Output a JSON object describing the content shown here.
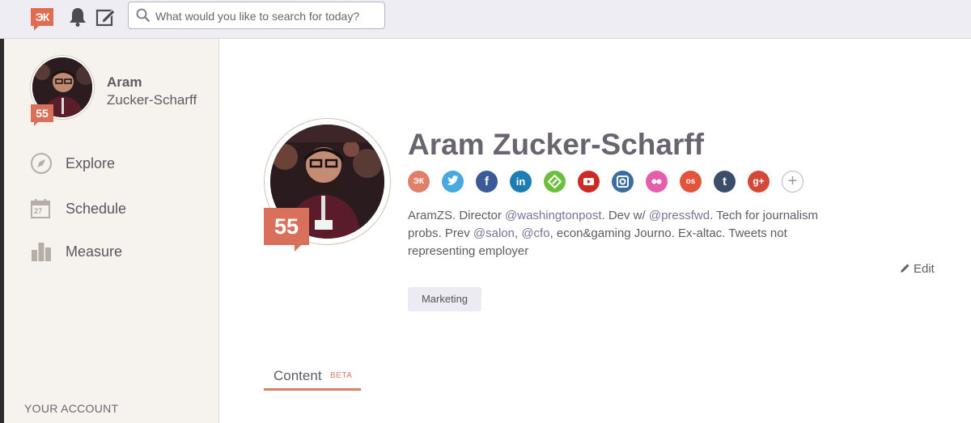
{
  "topbar": {
    "logo_text": "ЭК",
    "search_placeholder": "What would you like to search for today?",
    "icons": [
      "klout-logo-icon",
      "bell-icon",
      "compose-icon",
      "search-icon"
    ]
  },
  "sidebar": {
    "first_name": "Aram",
    "last_name": "Zucker-Scharff",
    "score": "55",
    "nav": [
      {
        "label": "Explore",
        "icon": "compass-icon"
      },
      {
        "label": "Schedule",
        "icon": "calendar-icon"
      },
      {
        "label": "Measure",
        "icon": "bar-chart-icon"
      }
    ],
    "calendar_day": "27",
    "account_label": "YOUR ACCOUNT"
  },
  "profile": {
    "name": "Aram Zucker-Scharff",
    "score": "55",
    "socials": [
      {
        "name": "klout",
        "glyph": "ЭК",
        "color": "#e0806a"
      },
      {
        "name": "twitter",
        "glyph": "t",
        "color": "#4aa8e0"
      },
      {
        "name": "facebook",
        "glyph": "f",
        "color": "#3b5b98"
      },
      {
        "name": "linkedin",
        "glyph": "in",
        "color": "#1f7cb4"
      },
      {
        "name": "feedly",
        "glyph": "f",
        "color": "#6cbf3c"
      },
      {
        "name": "youtube",
        "glyph": "▶",
        "color": "#cc2a24"
      },
      {
        "name": "instagram",
        "glyph": "◎",
        "color": "#3b6da0"
      },
      {
        "name": "flickr",
        "glyph": "••",
        "color": "#e35fae"
      },
      {
        "name": "lastfm",
        "glyph": "os",
        "color": "#e2543c"
      },
      {
        "name": "tumblr",
        "glyph": "t",
        "color": "#3a4e6a"
      },
      {
        "name": "googleplus",
        "glyph": "g+",
        "color": "#d34836"
      },
      {
        "name": "add",
        "glyph": "+",
        "color": "#ffffff"
      }
    ],
    "bio": {
      "p1": "AramZS. Director ",
      "m1": "@washingtonpost",
      "p2": ". Dev w/ ",
      "m2": "@pressfwd",
      "p3": ". Tech for journalism probs. Prev ",
      "m3": "@salon",
      "p4": ", ",
      "m4": "@cfo",
      "p5": ", econ&gaming Journo. Ex-altac. Tweets not representing employer"
    },
    "edit_label": "Edit",
    "topic_tag": "Marketing"
  },
  "tabs": {
    "content_label": "Content",
    "content_badge": "BETA"
  },
  "colors": {
    "accent": "#d8705b",
    "topbar_bg": "#efedf4",
    "sidebar_bg": "#f6f3ee"
  }
}
